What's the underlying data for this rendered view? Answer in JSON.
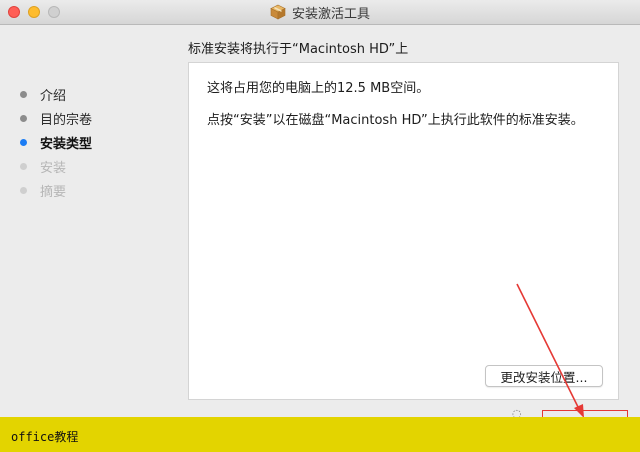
{
  "window": {
    "title": "安装激活工具",
    "header": "标准安装将执行于“Macintosh HD”上"
  },
  "sidebar": {
    "steps": [
      {
        "label": "介绍",
        "state": "done"
      },
      {
        "label": "目的宗卷",
        "state": "done"
      },
      {
        "label": "安装类型",
        "state": "active"
      },
      {
        "label": "安装",
        "state": "future"
      },
      {
        "label": "摘要",
        "state": "future"
      }
    ]
  },
  "content": {
    "line1": "这将占用您的电脑上的12.5 MB空间。",
    "line2": "点按“安装”以在磁盘“Macintosh HD”上执行此软件的标准安装。",
    "change_location_label": "更改安装位置..."
  },
  "banner": {
    "text": "office教程"
  },
  "colors": {
    "accent": "#1b7cf4",
    "annotation": "#e53935",
    "banner": "#e3d400"
  },
  "icons": {
    "package": "package-icon"
  }
}
